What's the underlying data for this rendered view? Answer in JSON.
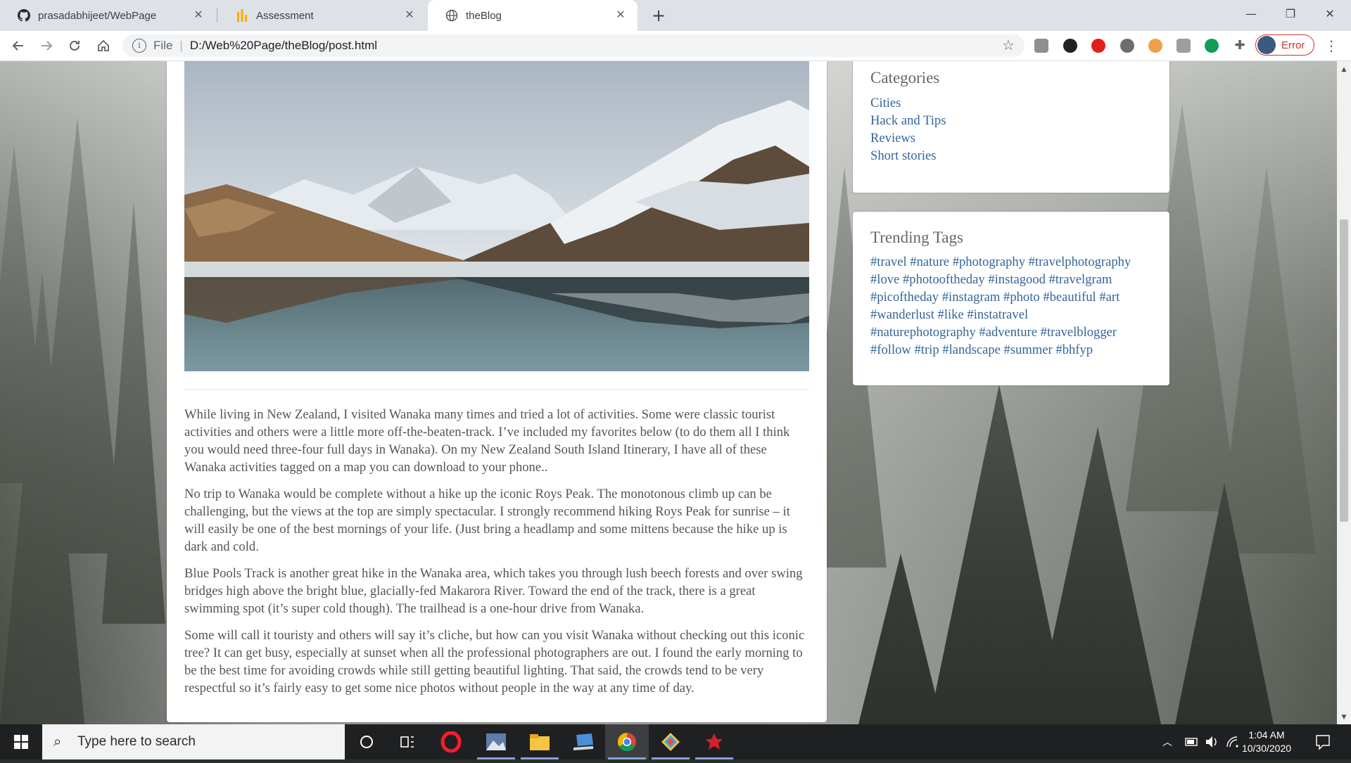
{
  "browser": {
    "tabs": [
      {
        "title": "prasadabhijeet/WebPage",
        "icon": "github-icon",
        "active": false
      },
      {
        "title": "Assessment",
        "icon": "chart-bars-icon",
        "active": false
      },
      {
        "title": "theBlog",
        "icon": "globe-icon",
        "active": true
      }
    ],
    "close_glyph": "✕",
    "new_tab_glyph": "+",
    "omnibox": {
      "scheme_label": "File",
      "separator": "|",
      "url": "D:/Web%20Page/theBlog/post.html"
    },
    "profile": {
      "label": "Error"
    },
    "colors": {
      "tabstrip": "#dee1e6",
      "error": "#d93025",
      "link": "#34659a"
    }
  },
  "post": {
    "image_alt": "snowy mountains reflected in an alpine lake",
    "paragraphs": [
      "While living in New Zealand, I visited Wanaka many times and tried a lot of activities. Some were classic tourist activities and others were a little more off-the-beaten-track. I’ve included my favorites below (to do them all I think you would need three-four full days in Wanaka). On my New Zealand South Island Itinerary, I have all of these Wanaka activities tagged on a map you can download to your phone..",
      "No trip to Wanaka would be complete without a hike up the iconic Roys Peak. The monotonous climb up can be challenging, but the views at the top are simply spectacular. I strongly recommend hiking Roys Peak for sunrise – it will easily be one of the best mornings of your life. (Just bring a headlamp and some mittens because the hike up is dark and cold.",
      "Blue Pools Track is another great hike in the Wanaka area, which takes you through lush beech forests and over swing bridges high above the bright blue, glacially-fed Makarora River. Toward the end of the track, there is a great swimming spot (it’s super cold though). The trailhead is a one-hour drive from Wanaka.",
      "Some will call it touristy and others will say it’s cliche, but how can you visit Wanaka without checking out this iconic tree? It can get busy, especially at sunset when all the professional photographers are out. I found the early morning to be the best time for avoiding crowds while still getting beautiful lighting. That said, the crowds tend to be very respectful so it’s fairly easy to get some nice photos without people in the way at any time of day."
    ]
  },
  "sidebar": {
    "categories": {
      "title": "Categories",
      "items": [
        "Cities",
        "Hack and Tips",
        "Reviews",
        "Short stories"
      ]
    },
    "tags": {
      "title": "Trending Tags",
      "lines": [
        [
          "#travel",
          "#nature",
          "#photography",
          "#travelphotography"
        ],
        [
          "#love",
          "#photooftheday",
          "#instagood",
          "#travelgram"
        ],
        [
          "#picoftheday",
          "#instagram",
          "#photo",
          "#beautiful",
          "#art"
        ],
        [
          "#wanderlust",
          "#like",
          "#instatravel"
        ],
        [
          "#naturephotography",
          "#adventure",
          "#travelblogger"
        ],
        [
          "#follow",
          "#trip",
          "#landscape",
          "#summer",
          "#bhfyp"
        ]
      ]
    }
  },
  "taskbar": {
    "search_placeholder": "Type here to search",
    "time": "1:04 AM",
    "date": "10/30/2020",
    "apps": [
      "cortana-icon",
      "task-view-icon",
      "opera-icon",
      "photos-icon",
      "file-explorer-icon",
      "laptop-icon",
      "chrome-icon",
      "git-icon",
      "app-icon"
    ]
  }
}
